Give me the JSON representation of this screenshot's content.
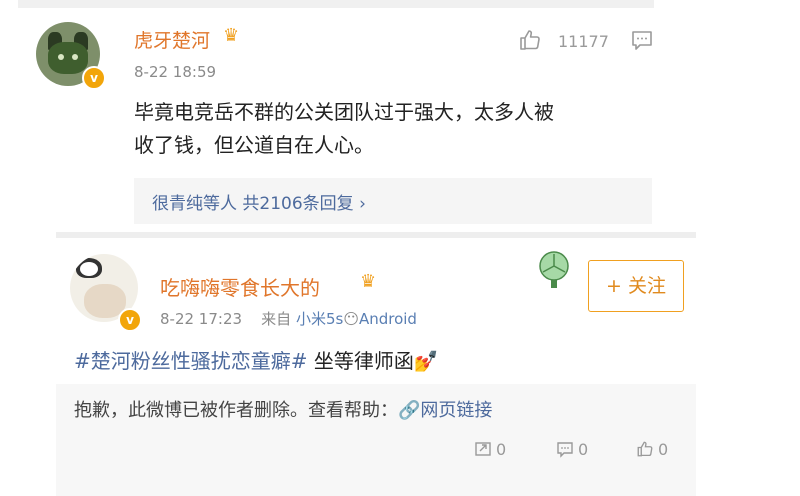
{
  "comment": {
    "user_name": "虎牙楚河",
    "time": "8-22 18:59",
    "like_count": "11177",
    "text_line1": "毕竟电竞岳不群的公关团队过于强大，太多人被",
    "text_line2": "收了钱，但公道自在人心。",
    "replies_summary": "很青纯等人  共2106条回复 ›",
    "verified_badge": "v",
    "crown_icon": "crown-icon"
  },
  "post": {
    "user_name": "吃嗨嗨零食长大的",
    "time": "8-22 17:23",
    "source_prefix": "来自",
    "source_device": "小米5s",
    "source_suffix": "Android",
    "follow_label": "+ 关注",
    "hashtag": "#楚河粉丝性骚扰恋童癖#",
    "text_after": " 坐等律师函",
    "deleted_notice": "抱歉，此微博已被作者删除。查看帮助：",
    "help_link": "网页链接",
    "repost_count": "0",
    "comment_count": "0",
    "like_count": "0",
    "verified_badge": "v"
  },
  "colors": {
    "username": "#e0762b",
    "link": "#4d6a9d",
    "follow": "#f0a020"
  }
}
